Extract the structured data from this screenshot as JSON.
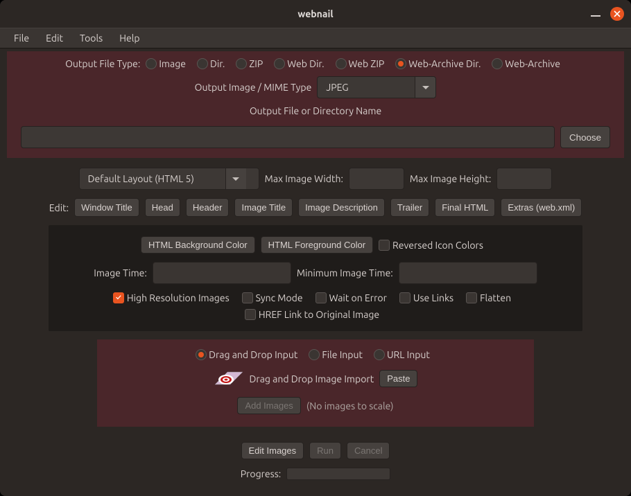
{
  "titlebar": {
    "title": "webnail"
  },
  "menu": {
    "file": "File",
    "edit": "Edit",
    "tools": "Tools",
    "help": "Help"
  },
  "output": {
    "file_type_label": "Output File Type:",
    "types": {
      "image": "Image",
      "dir": "Dir.",
      "zip": "ZIP",
      "webdir": "Web Dir.",
      "webzip": "Web ZIP",
      "webarchdir": "Web-Archive Dir.",
      "webarch": "Web-Archive"
    },
    "mime_label": "Output Image / MIME Type",
    "mime_value": "JPEG",
    "name_label": "Output File or Directory Name",
    "name_value": "",
    "choose": "Choose"
  },
  "layout": {
    "select_value": "Default Layout (HTML 5)",
    "max_w_label": "Max Image Width:",
    "max_w_value": "",
    "max_h_label": "Max Image Height:",
    "max_h_value": ""
  },
  "editsec": {
    "label": "Edit:",
    "buttons": {
      "window_title": "Window Title",
      "head": "Head",
      "header": "Header",
      "image_title": "Image Title",
      "image_desc": "Image Description",
      "trailer": "Trailer",
      "final_html": "Final HTML",
      "extras": "Extras (web.xml)"
    }
  },
  "dark": {
    "bg_color": "HTML Background Color",
    "fg_color": "HTML Foreground Color",
    "reversed_icons": "Reversed Icon Colors",
    "image_time_label": "Image Time:",
    "image_time_value": "",
    "min_image_time_label": "Minimum Image Time:",
    "min_image_time_value": "",
    "highres": "High Resolution Images",
    "sync": "Sync Mode",
    "wait": "Wait on Error",
    "links": "Use Links",
    "flatten": "Flatten",
    "href": "HREF Link to Original Image"
  },
  "input": {
    "dnd": "Drag and Drop Input",
    "file": "File Input",
    "url": "URL Input",
    "dnd_import": "Drag and Drop Image Import",
    "paste": "Paste",
    "add_images": "Add Images",
    "no_images": "(No images to scale)"
  },
  "actions": {
    "edit_images": "Edit Images",
    "run": "Run",
    "cancel": "Cancel",
    "progress_label": "Progress:"
  }
}
